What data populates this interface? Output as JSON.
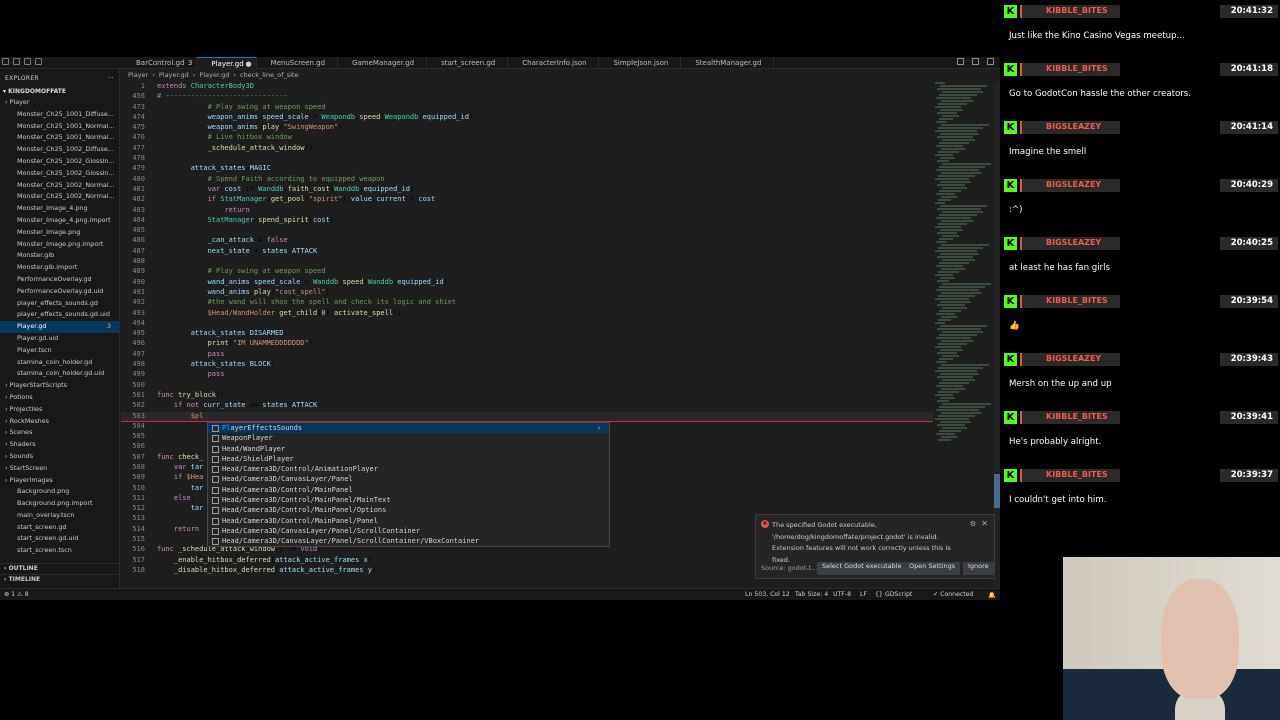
{
  "editor": {
    "tabs": [
      {
        "label": "BarControl.gd",
        "dirty": "3",
        "active": false
      },
      {
        "label": "Player.gd",
        "dirty": "●",
        "active": true
      },
      {
        "label": "MenuScreen.gd",
        "dirty": "",
        "active": false
      },
      {
        "label": "GameManager.gd",
        "dirty": "",
        "active": false
      },
      {
        "label": "start_screen.gd",
        "dirty": "",
        "active": false
      },
      {
        "label": "CharacterInfo.json",
        "dirty": "",
        "active": false
      },
      {
        "label": "SimpleJson.json",
        "dirty": "",
        "active": false
      },
      {
        "label": "StealthManager.gd",
        "dirty": "",
        "active": false
      }
    ],
    "breadcrumb": [
      "Player",
      "›",
      "Player.gd",
      "›",
      "Player.gd",
      "›",
      "check_line_of_site"
    ],
    "sidebar": {
      "title": "EXPLORER",
      "project": "KINGDOMOFFATE",
      "items": [
        {
          "label": "Player",
          "folder": true
        },
        {
          "label": "Monster_Ch25_1001_Diffuse..."
        },
        {
          "label": "Monster_Ch25_1001_Normal..."
        },
        {
          "label": "Monster_Ch25_1001_Normal..."
        },
        {
          "label": "Monster_Ch25_1002_Diffuse..."
        },
        {
          "label": "Monster_Ch25_1002_Glossin..."
        },
        {
          "label": "Monster_Ch25_1002_Glossin..."
        },
        {
          "label": "Monster_Ch25_1002_Normal..."
        },
        {
          "label": "Monster_Ch25_1002_Normal..."
        },
        {
          "label": "Monster_Image_4.png"
        },
        {
          "label": "Monster_Image_4.png.import"
        },
        {
          "label": "Monster_Image.png"
        },
        {
          "label": "Monster_Image.png.import"
        },
        {
          "label": "Monster.glb"
        },
        {
          "label": "Monster.glb.import"
        },
        {
          "label": "PerformanceOverlay.gd"
        },
        {
          "label": "PerformanceOverlay.gd.uid"
        },
        {
          "label": "player_effects_sounds.gd"
        },
        {
          "label": "player_effects_sounds.gd.uid"
        },
        {
          "label": "Player.gd",
          "selected": true,
          "badge": "3"
        },
        {
          "label": "Player.gd.uid"
        },
        {
          "label": "Player.tscn"
        },
        {
          "label": "stamina_coin_holder.gd"
        },
        {
          "label": "stamina_coin_holder.gd.uid"
        },
        {
          "label": "PlayerStartScripts",
          "folder": true
        },
        {
          "label": "Potions",
          "folder": true
        },
        {
          "label": "Projectiles",
          "folder": true
        },
        {
          "label": "RockMeshes",
          "folder": true
        },
        {
          "label": "Scenes",
          "folder": true
        },
        {
          "label": "Shaders",
          "folder": true
        },
        {
          "label": "Sounds",
          "folder": true
        },
        {
          "label": "StartScreen",
          "folder": true
        },
        {
          "label": "PlayerImages",
          "folder": true
        },
        {
          "label": "Background.png"
        },
        {
          "label": "Background.png.import"
        },
        {
          "label": "main_overlay.tscn"
        },
        {
          "label": "start_screen.gd"
        },
        {
          "label": "start_screen.gd.uid"
        },
        {
          "label": "start_screen.tscn"
        }
      ],
      "outline": "OUTLINE",
      "timeline": "TIMELINE"
    },
    "code_lines": [
      {
        "n": "1",
        "html": "<span class='k'>extends</span> <span class='ty'>CharacterBody3D</span>"
      },
      {
        "n": "456",
        "html": "<span class='c'># -----------------------------</span>"
      },
      {
        "n": "473",
        "html": "            <span class='c'># Play swing at weapon speed</span>"
      },
      {
        "n": "474",
        "html": "            <span class='v'>weapon_anims</span>.<span class='v'>speed_scale</span> = <span class='ty'>Weapondb</span>.<span class='f'>speed</span>(<span class='ty'>Weapondb</span>.<span class='v'>equipped_id</span>)"
      },
      {
        "n": "475",
        "html": "            <span class='v'>weapon_anims</span>.<span class='f'>play</span>(<span class='s'>\"SwingWeapon\"</span>)"
      },
      {
        "n": "476",
        "html": "            <span class='c'># Live hitbox window</span>"
      },
      {
        "n": "477",
        "html": "            <span class='f'>_schedule_attack_window</span>()"
      },
      {
        "n": "478",
        "html": ""
      },
      {
        "n": "479",
        "html": "        <span class='v'>attack_states</span>.<span class='v'>MAGIC</span>:"
      },
      {
        "n": "480",
        "html": "            <span class='c'># Spend Faith according to equipped weapon</span>"
      },
      {
        "n": "481",
        "html": "            <span class='k'>var</span> <span class='v'>cost</span> := <span class='ty'>Wanddb</span>.<span class='f'>faith_cost</span>(<span class='ty'>Wanddb</span>.<span class='v'>equipped_id</span>)"
      },
      {
        "n": "482",
        "html": "            <span class='k'>if</span> <span class='ty'>StatManager</span>.<span class='f'>get_pool</span>(<span class='s'>\"spirit\"</span>).<span class='v'>value</span>.<span class='v'>current</span> &lt; <span class='v'>cost</span>:"
      },
      {
        "n": "483",
        "html": "                <span class='k'>return</span>"
      },
      {
        "n": "484",
        "html": "            <span class='ty'>StatManager</span>.<span class='f'>spend_spirit</span>(<span class='v'>cost</span>)"
      },
      {
        "n": "485",
        "html": ""
      },
      {
        "n": "486",
        "html": "            <span class='v'>_can_attack</span> = <span class='k'>false</span>"
      },
      {
        "n": "487",
        "html": "            <span class='v'>next_state</span> = <span class='v'>states</span>.<span class='v'>ATTACK</span>"
      },
      {
        "n": "488",
        "html": ""
      },
      {
        "n": "489",
        "html": "            <span class='c'># Play swing at weapon speed</span>"
      },
      {
        "n": "490",
        "html": "            <span class='v'>wand_anims</span>.<span class='v'>speed_scale</span> = <span class='ty'>Wanddb</span>.<span class='f'>speed</span>(<span class='ty'>Wanddb</span>.<span class='v'>equipped_id</span>)"
      },
      {
        "n": "491",
        "html": "            <span class='v'>wand_anims</span>.<span class='f'>play</span>(<span class='s'>\"cast_spell\"</span>)"
      },
      {
        "n": "492",
        "html": "            <span class='c'>#the wand will shoo the spell and check its logic and shiet</span>"
      },
      {
        "n": "493",
        "html": "            <span class='s'>$Head/WandHolder</span>.<span class='f'>get_child</span>(<span class='n'>0</span>).<span class='f'>activate_spell</span>()"
      },
      {
        "n": "494",
        "html": ""
      },
      {
        "n": "495",
        "html": "        <span class='v'>attack_states</span>.<span class='v'>DISARMED</span>:"
      },
      {
        "n": "496",
        "html": "            <span class='f'>print</span>(<span class='s'>\"IM UNAMMEDDDDDDD\"</span>)"
      },
      {
        "n": "497",
        "html": "            <span class='k'>pass</span>"
      },
      {
        "n": "498",
        "html": "        <span class='v'>attack_states</span>.<span class='v'>BLOCK</span>:"
      },
      {
        "n": "499",
        "html": "            <span class='k'>pass</span>"
      },
      {
        "n": "500",
        "html": ""
      },
      {
        "n": "501",
        "html": "<span class='k'>func</span> <span class='f'>try_block</span>():"
      },
      {
        "n": "502",
        "html": "    <span class='k'>if not</span> <span class='v'>curr_state</span> == <span class='v'>states</span>.<span class='v'>ATTACK</span>:"
      },
      {
        "n": "503",
        "html": "        <span class='s'>$pl</span>",
        "cur": true
      },
      {
        "n": "504",
        "html": ""
      },
      {
        "n": "505",
        "html": ""
      },
      {
        "n": "506",
        "html": ""
      },
      {
        "n": "507",
        "html": "<span class='k'>func</span> <span class='f'>check_</span>"
      },
      {
        "n": "508",
        "html": "    <span class='k'>var</span> <span class='v'>tar</span>"
      },
      {
        "n": "509",
        "html": "    <span class='k'>if</span> <span class='s'>$Hea</span>"
      },
      {
        "n": "510",
        "html": "        <span class='v'>tar</span>"
      },
      {
        "n": "511",
        "html": "    <span class='k'>else</span>:"
      },
      {
        "n": "512",
        "html": "        <span class='v'>tar</span>                                                                                  <span class='v'>position</span>"
      },
      {
        "n": "513",
        "html": ""
      },
      {
        "n": "514",
        "html": "    <span class='k'>return</span>"
      },
      {
        "n": "515",
        "html": ""
      },
      {
        "n": "516",
        "html": "<span class='k'>func</span> <span class='f'>_schedule_attack_window</span>() -&gt; <span class='k'>void</span>:"
      },
      {
        "n": "517",
        "html": "    <span class='f'>_enable_hitbox_deferred</span>(<span class='v'>attack_active_frames</span>.<span class='v'>x</span>)"
      },
      {
        "n": "518",
        "html": "    <span class='f'>_disable_hitbox_deferred</span>(<span class='v'>attack_active_frames</span>.<span class='v'>y</span>)"
      }
    ],
    "suggestions": [
      {
        "pre": "Pl",
        "rest": "ayerEffectsSounds"
      },
      {
        "pre": "",
        "rest": "WeaponPlayer"
      },
      {
        "pre": "",
        "rest": "Head/WandPlayer"
      },
      {
        "pre": "",
        "rest": "Head/ShieldPlayer"
      },
      {
        "pre": "",
        "rest": "Head/Camera3D/Control/AnimationPlayer"
      },
      {
        "pre": "",
        "rest": "Head/Camera3D/CanvasLayer/Panel"
      },
      {
        "pre": "",
        "rest": "Head/Camera3D/Control/MainPanel"
      },
      {
        "pre": "",
        "rest": "Head/Camera3D/Control/MainPanel/MainText"
      },
      {
        "pre": "",
        "rest": "Head/Camera3D/Control/MainPanel/Options"
      },
      {
        "pre": "",
        "rest": "Head/Camera3D/Control/MainPanel/Panel"
      },
      {
        "pre": "",
        "rest": "Head/Camera3D/CanvasLayer/Panel/ScrollContainer"
      },
      {
        "pre": "",
        "rest": "Head/Camera3D/CanvasLayer/Panel/ScrollContainer/VBoxContainer"
      }
    ],
    "notification": {
      "message_line1": "The specified Godot executable,",
      "message_line2": "'/home/dog/kingdomoffate/project.godot' is invalid.",
      "message_line3": "Extension features will not work correctly unless this is fixed.",
      "source": "Source: godot-t...",
      "btn_select": "Select Godot executable",
      "btn_settings": "Open Settings",
      "btn_ignore": "Ignore"
    },
    "status": {
      "problems": "⊗ 1 ⚠ 8",
      "position": "Ln 503, Col 12",
      "tab_size": "Tab Size: 4",
      "encoding": "UTF-8",
      "eol": "LF",
      "language": "{} GDScript",
      "connection": "✓ Connected"
    }
  },
  "chat": {
    "messages": [
      {
        "user": "KIBBLE_BITES",
        "time": "20:41:32",
        "text": "Just like the Kino Casino Vegas meetup..."
      },
      {
        "user": "KIBBLE_BITES",
        "time": "20:41:18",
        "text": "Go to GodotCon hassle the other creators."
      },
      {
        "user": "BIGSLEAZEY",
        "time": "20:41:14",
        "text": "Imagine the smell"
      },
      {
        "user": "BIGSLEAZEY",
        "time": "20:40:29",
        "text": ":^)"
      },
      {
        "user": "BIGSLEAZEY",
        "time": "20:40:25",
        "text": "at least he has fan girls"
      },
      {
        "user": "KIBBLE_BITES",
        "time": "20:39:54",
        "text": "👍"
      },
      {
        "user": "BIGSLEAZEY",
        "time": "20:39:43",
        "text": "Mersh on the up and up"
      },
      {
        "user": "KIBBLE_BITES",
        "time": "20:39:41",
        "text": "He's probably alright."
      },
      {
        "user": "KIBBLE_BITES",
        "time": "20:39:37",
        "text": "I couldn't get into him."
      }
    ]
  },
  "icons": {
    "kick": "kick-logo-icon"
  }
}
